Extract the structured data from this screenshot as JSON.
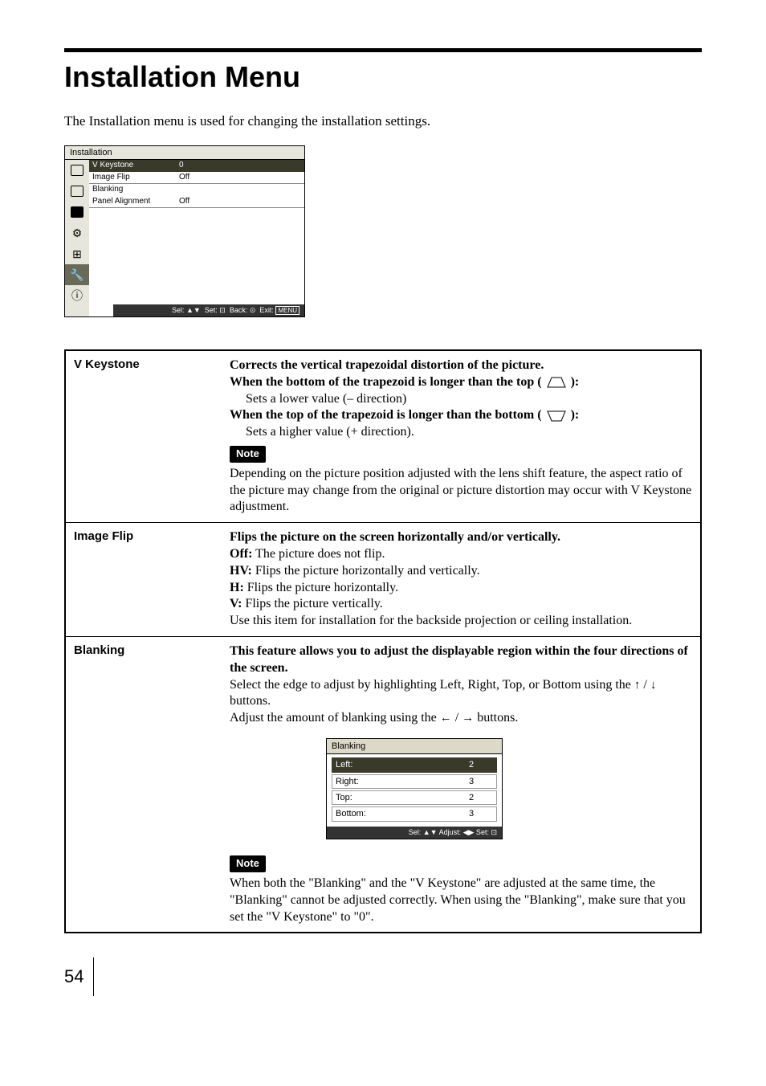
{
  "heading": "Installation Menu",
  "intro": "The Installation menu is used for changing the installation settings.",
  "menu": {
    "title": "Installation",
    "rows": [
      {
        "label": "V Keystone",
        "value": "0",
        "selected": true
      },
      {
        "label": "Image Flip",
        "value": "Off",
        "selected": false
      },
      {
        "label": "Blanking",
        "value": "",
        "selected": false
      },
      {
        "label": "Panel Alignment",
        "value": "Off",
        "selected": false
      }
    ],
    "footer_sel": "Sel:",
    "footer_set": "Set:",
    "footer_back": "Back:",
    "footer_exit": "Exit:",
    "footer_menu": "MENU"
  },
  "table": {
    "vkeystone": {
      "label": "V Keystone",
      "line1": "Corrects the vertical trapezoidal distortion of the picture.",
      "line2a": "When the bottom of the trapezoid is longer than the top (",
      "line2b": "):",
      "line2c": "Sets a lower value (– direction)",
      "line3a": "When the top of the trapezoid is longer than the bottom (",
      "line3b": "):",
      "line3c": "Sets a higher value (+ direction).",
      "note": "Note",
      "note_text": "Depending on the picture position adjusted with the lens shift feature, the aspect ratio of the picture may change from the original or picture distortion may occur with V Keystone adjustment."
    },
    "imageflip": {
      "label": "Image Flip",
      "line1": "Flips the picture on the screen horizontally and/or vertically.",
      "off_l": "Off:",
      "off_t": " The picture does not flip.",
      "hv_l": "HV:",
      "hv_t": " Flips the picture horizontally and vertically.",
      "h_l": "H:",
      "h_t": " Flips the picture horizontally.",
      "v_l": "V:",
      "v_t": " Flips the picture vertically.",
      "line6": "Use this item for installation for the backside projection or ceiling installation."
    },
    "blanking": {
      "label": "Blanking",
      "line1": "This feature allows you to adjust the displayable region within the four directions of the screen.",
      "line2": "Select the edge to adjust by highlighting Left, Right, Top, or Bottom using the ",
      "line2b": " buttons.",
      "line3": "Adjust the amount of blanking using the ",
      "line3b": " buttons.",
      "note": "Note",
      "note_text": "When both the \"Blanking\" and the \"V Keystone\" are adjusted at the same time, the \"Blanking\" cannot be adjusted correctly. When using the \"Blanking\", make sure that you set the \"V Keystone\" to \"0\"."
    }
  },
  "blanking_box": {
    "title": "Blanking",
    "rows": [
      {
        "label": "Left:",
        "value": "2",
        "selected": true
      },
      {
        "label": "Right:",
        "value": "3",
        "selected": false
      },
      {
        "label": "Top:",
        "value": "2",
        "selected": false
      },
      {
        "label": "Bottom:",
        "value": "3",
        "selected": false
      }
    ],
    "footer": "Sel: ▲▼   Adjust: ◀▶   Set: ⊡"
  },
  "page": "54"
}
